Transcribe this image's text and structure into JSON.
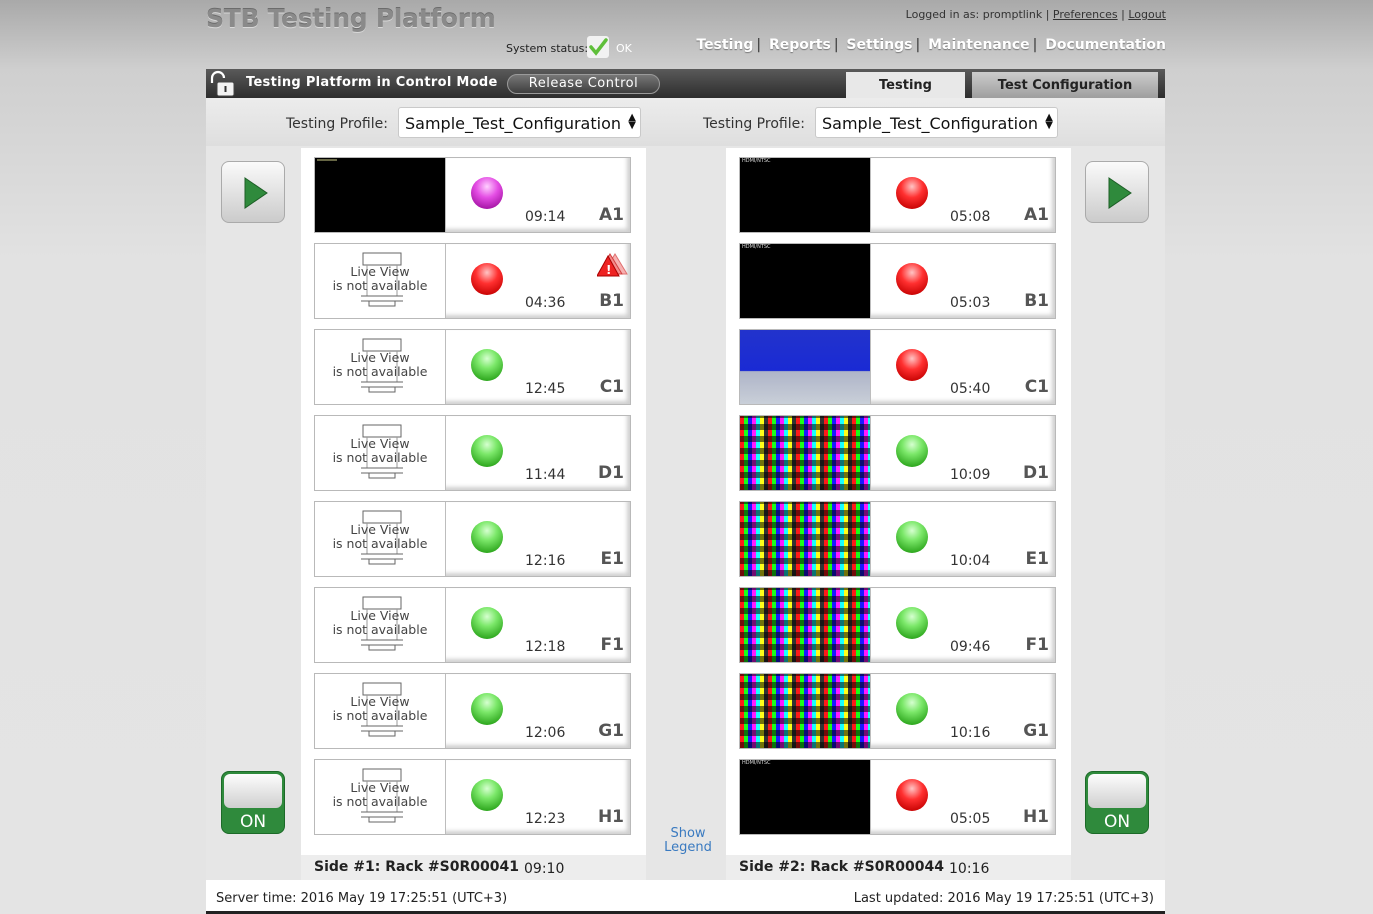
{
  "app_title": "STB Testing Platform",
  "user": {
    "logged_in_label": "Logged in as:",
    "username": "promptlink",
    "preferences": "Preferences",
    "logout": "Logout"
  },
  "system_status": {
    "label": "System status:",
    "value": "OK"
  },
  "nav": [
    "Testing",
    "Reports",
    "Settings",
    "Maintenance",
    "Documentation"
  ],
  "control": {
    "title": "Testing Platform in Control Mode",
    "release_button": "Release Control"
  },
  "tabs": [
    "Testing",
    "Test Configuration"
  ],
  "profile": {
    "label": "Testing Profile:",
    "left_value": "Sample_Test_Configuration",
    "right_value": "Sample_Test_Configuration"
  },
  "live_view_na": {
    "line1": "Live View",
    "line2": "is not available"
  },
  "hdmi_tag": "HDMI/NTSC",
  "side1": {
    "footer": "Side #1: Rack #S0R00041",
    "footer_time": "09:10",
    "power_label": "ON",
    "slots": [
      {
        "id": "A1",
        "time": "09:14",
        "status": "purple",
        "view": "black"
      },
      {
        "id": "B1",
        "time": "04:36",
        "status": "red",
        "view": "na",
        "alert": true
      },
      {
        "id": "C1",
        "time": "12:45",
        "status": "green",
        "view": "na"
      },
      {
        "id": "D1",
        "time": "11:44",
        "status": "green",
        "view": "na"
      },
      {
        "id": "E1",
        "time": "12:16",
        "status": "green",
        "view": "na"
      },
      {
        "id": "F1",
        "time": "12:18",
        "status": "green",
        "view": "na"
      },
      {
        "id": "G1",
        "time": "12:06",
        "status": "green",
        "view": "na"
      },
      {
        "id": "H1",
        "time": "12:23",
        "status": "green",
        "view": "na"
      }
    ]
  },
  "side2": {
    "footer": "Side #2: Rack #S0R00044",
    "footer_time": "10:16",
    "power_label": "ON",
    "slots": [
      {
        "id": "A1",
        "time": "05:08",
        "status": "red",
        "view": "black"
      },
      {
        "id": "B1",
        "time": "05:03",
        "status": "red",
        "view": "black"
      },
      {
        "id": "C1",
        "time": "05:40",
        "status": "red",
        "view": "blue"
      },
      {
        "id": "D1",
        "time": "10:09",
        "status": "green",
        "view": "pattern"
      },
      {
        "id": "E1",
        "time": "10:04",
        "status": "green",
        "view": "pattern"
      },
      {
        "id": "F1",
        "time": "09:46",
        "status": "green",
        "view": "pattern"
      },
      {
        "id": "G1",
        "time": "10:16",
        "status": "green",
        "view": "pattern"
      },
      {
        "id": "H1",
        "time": "05:05",
        "status": "red",
        "view": "black"
      }
    ]
  },
  "show_legend": "Show Legend",
  "footer": {
    "server_time": "Server time: 2016 May 19 17:25:51 (UTC+3)",
    "last_updated": "Last updated: 2016 May 19 17:25:51 (UTC+3)"
  },
  "colors": {
    "led_green": "#3fbf2f",
    "led_red": "#e01818",
    "led_purple": "#c030c0",
    "power_on": "#2f8a3c",
    "link": "#3a7ac0"
  }
}
